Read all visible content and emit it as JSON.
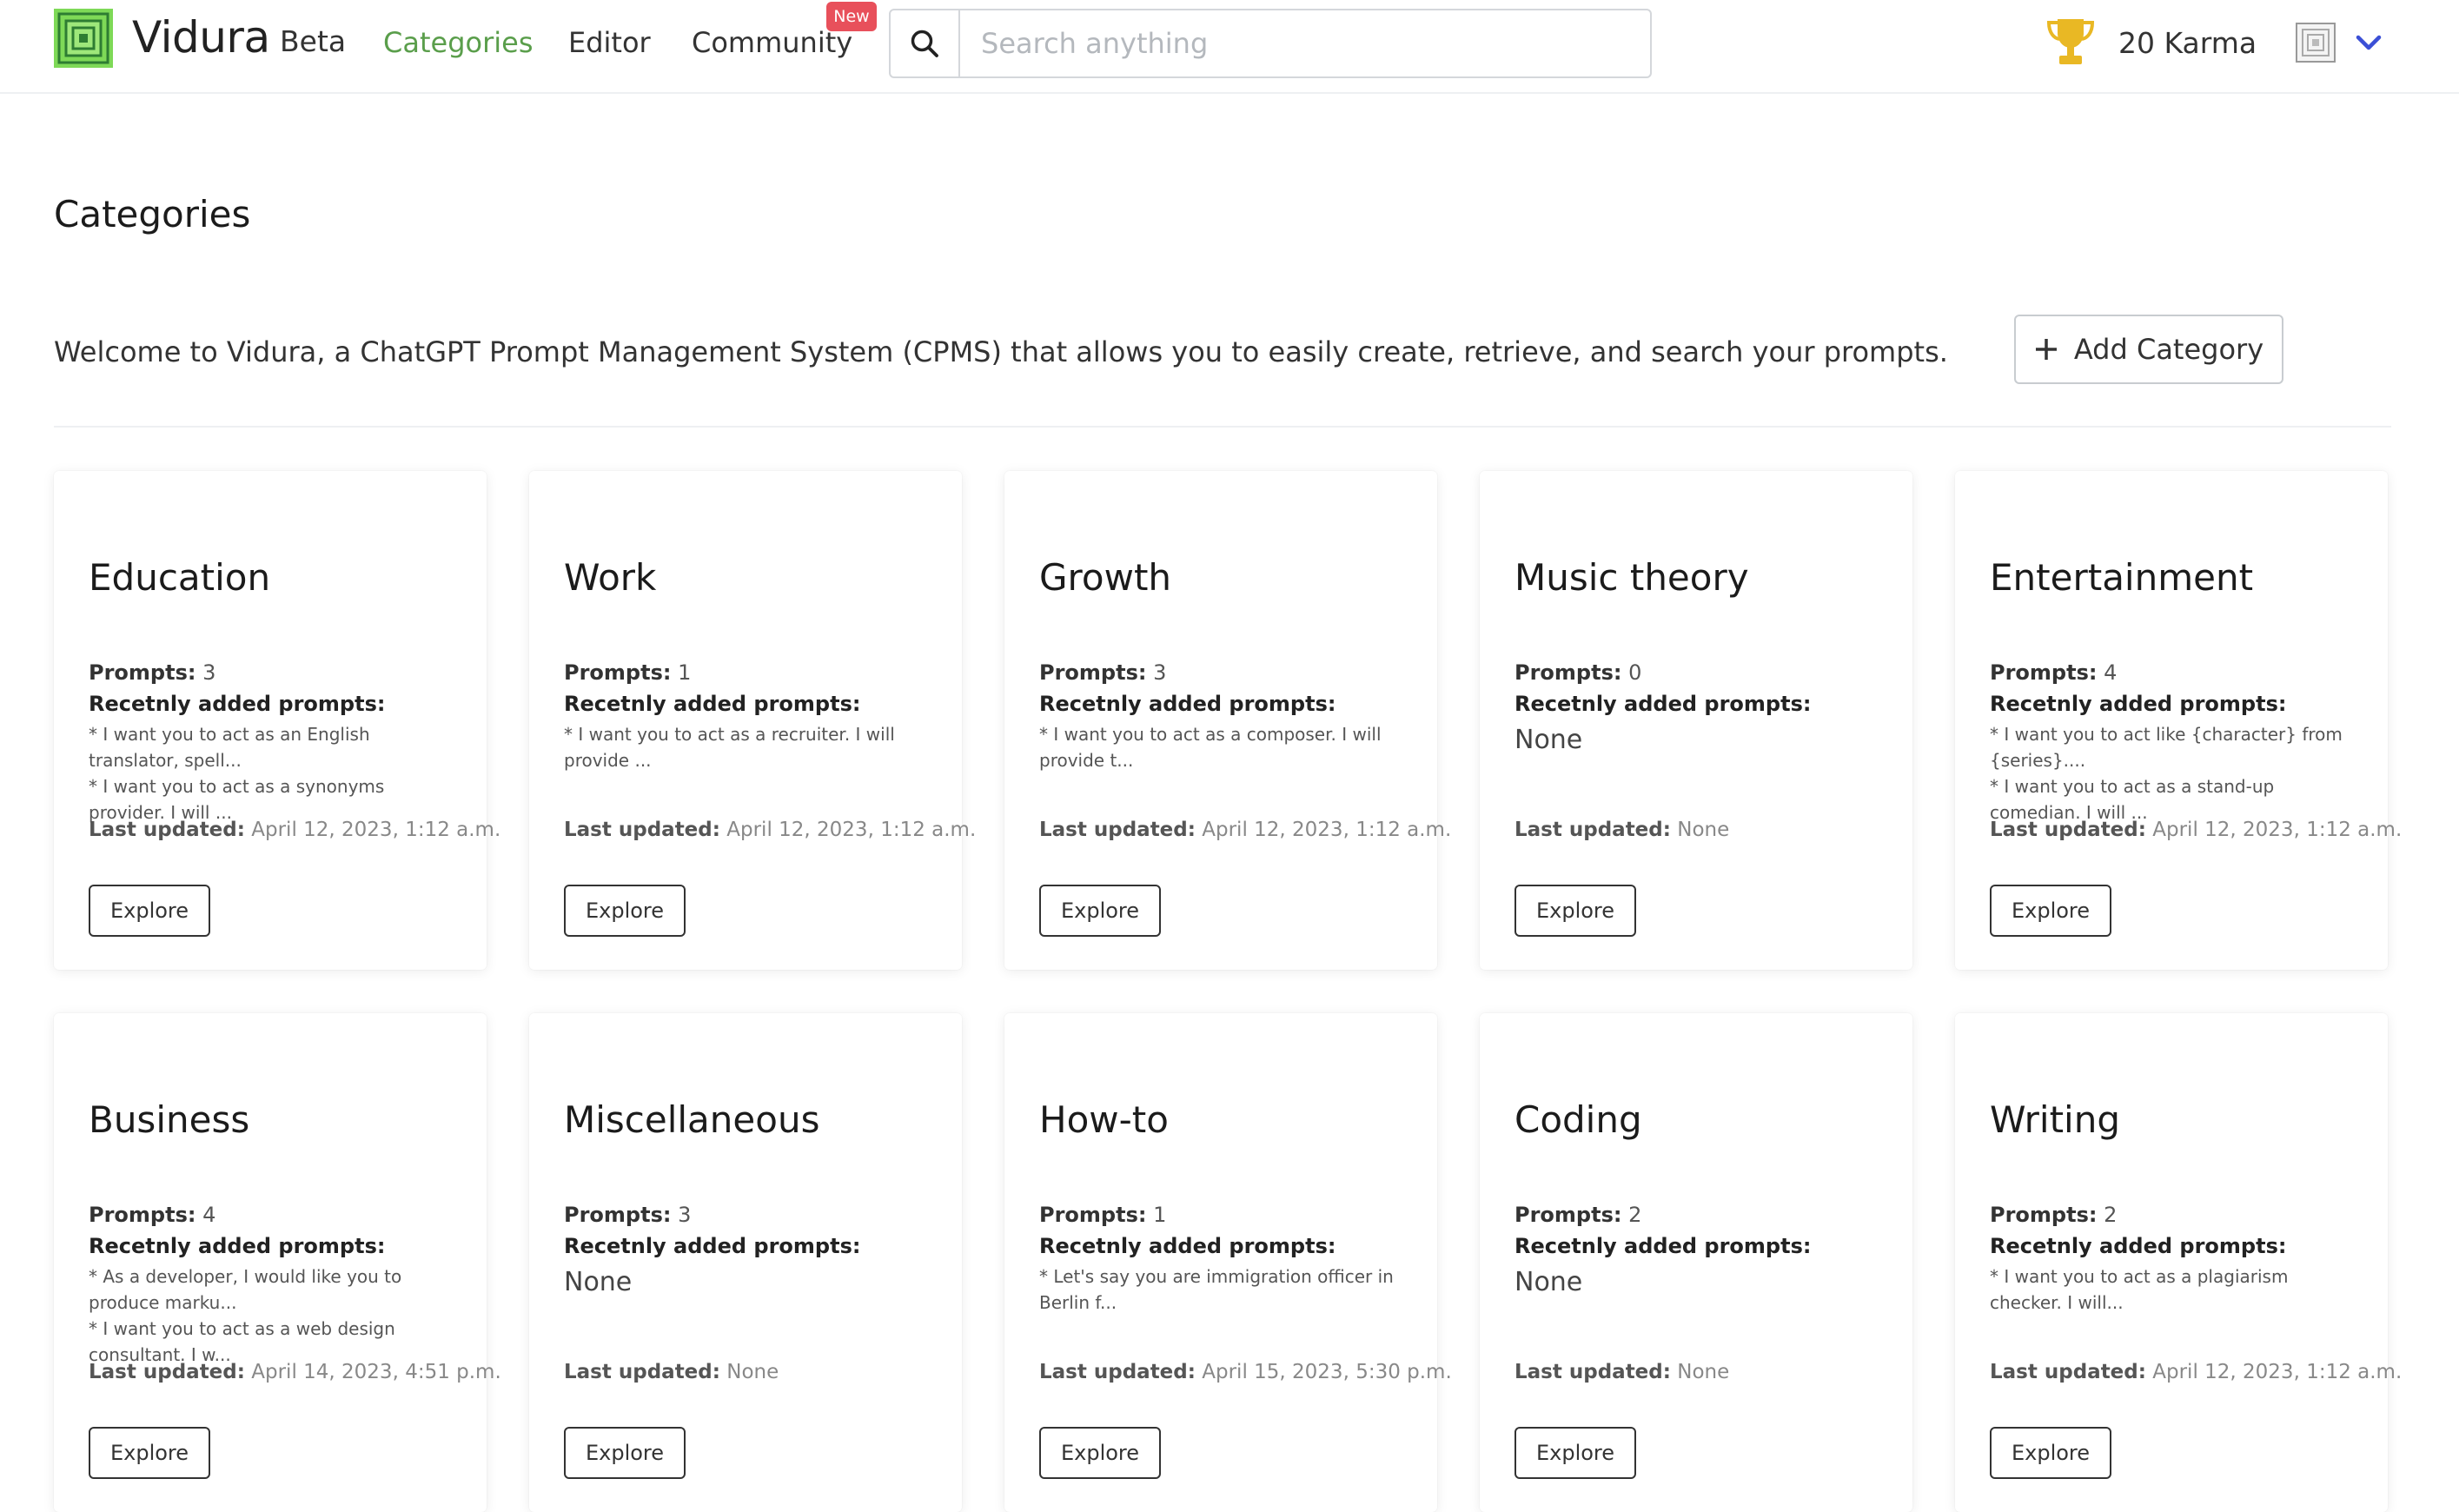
{
  "brand": {
    "name": "Vidura",
    "beta": "Beta"
  },
  "nav": [
    {
      "label": "Categories",
      "active": true
    },
    {
      "label": "Editor",
      "active": false
    },
    {
      "label": "Community",
      "active": false,
      "badge": "New"
    }
  ],
  "search": {
    "placeholder": "Search anything",
    "value": ""
  },
  "karma": "20 Karma",
  "page_title": "Categories",
  "welcome_text": "Welcome to Vidura, a ChatGPT Prompt Management System (CPMS) that allows you to easily create, retrieve, and search your prompts.",
  "add_category_label": "Add Category",
  "labels": {
    "prompts": "Prompts:",
    "recent": "Recetnly added prompts:",
    "last_updated": "Last updated:",
    "explore": "Explore"
  },
  "categories": [
    {
      "title": "Education",
      "prompts": "3",
      "recent": [
        "* I want you to act as an English translator, spell...",
        "* I want you to act as a synonyms provider. I will ..."
      ],
      "last_updated": "April 12, 2023, 1:12 a.m."
    },
    {
      "title": "Work",
      "prompts": "1",
      "recent": [
        "* I want you to act as a recruiter. I will provide ..."
      ],
      "last_updated": "April 12, 2023, 1:12 a.m."
    },
    {
      "title": "Growth",
      "prompts": "3",
      "recent": [
        "* I want you to act as a composer. I will provide t..."
      ],
      "last_updated": "April 12, 2023, 1:12 a.m."
    },
    {
      "title": "Music theory",
      "prompts": "0",
      "recent": [],
      "none_text": "None",
      "last_updated": "None"
    },
    {
      "title": "Entertainment",
      "prompts": "4",
      "recent": [
        "* I want you to act like {character} from {series}....",
        "* I want you to act as a stand-up comedian. I will ..."
      ],
      "last_updated": "April 12, 2023, 1:12 a.m."
    },
    {
      "title": "Business",
      "prompts": "4",
      "recent": [
        "* As a developer, I would like you to produce marku...",
        "* I want you to act as a web design consultant. I w..."
      ],
      "last_updated": "April 14, 2023, 4:51 p.m."
    },
    {
      "title": "Miscellaneous",
      "prompts": "3",
      "recent": [],
      "none_text": "None",
      "last_updated": "None"
    },
    {
      "title": "How-to",
      "prompts": "1",
      "recent": [
        "* Let's say you are immigration officer in Berlin f..."
      ],
      "last_updated": "April 15, 2023, 5:30 p.m."
    },
    {
      "title": "Coding",
      "prompts": "2",
      "recent": [],
      "none_text": "None",
      "last_updated": "None"
    },
    {
      "title": "Writing",
      "prompts": "2",
      "recent": [
        "* I want you to act as a plagiarism checker. I will..."
      ],
      "last_updated": "April 12, 2023, 1:12 a.m."
    }
  ],
  "colors": {
    "brand_green": "#5a9e4b",
    "badge_red": "#e8505b",
    "trophy_gold": "#e9b824",
    "chevron_blue": "#3b4fd6"
  },
  "icons": {
    "logo": "vidura-logo-icon",
    "search": "search-icon",
    "trophy": "trophy-icon",
    "avatar": "avatar-icon",
    "chevron": "chevron-down-icon",
    "plus": "plus-icon"
  }
}
